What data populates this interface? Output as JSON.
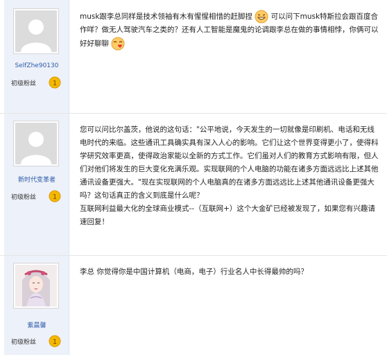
{
  "posts": [
    {
      "username": "SelfZhe90130",
      "rank": "初级粉丝",
      "medal": "1",
      "avatar": "default-avatar",
      "text_parts": [
        "musk跟李总同样是技术领袖有木有惺惺相惜的赶脚捏",
        "可以问下musk特斯拉会跟百度合作咩？做无人驾驶汽车之类的？还有人工智能是魔鬼的论调跟李总在做的事情相悖，你俩可以好好聊聊",
        ""
      ]
    },
    {
      "username": "新时代变革者",
      "rank": "初级粉丝",
      "medal": "1",
      "avatar": "default-avatar",
      "lines": [
        "您可以问比尔盖茨，他说的这句话：\"公平地说，今天发生的一切就像是印刷机、电话和无线电时代的来临。这些通讯工具确实具有深入人心的影响。它们让这个世界变得更小了，使得科学研究效率更高，使得政治家能以全新的方式工作。它们虽对人们的教育方式影响有限，但人们对他们将发生的巨大变化充满乐观。实现联网的个人电脑的功能在诸多方面远远比上述其他通讯设备更强大。\"现在实现联网的个人电脑真的在诸多方面远远比上述其他通讯设备更强大吗？这句话真正的含义到底是什么呢？",
        "互联网利益最大化的全球商业模式--（互联网+）这个大金矿已经被发现了，如果您有兴趣请速回复！"
      ]
    },
    {
      "username": "紫晨馨",
      "rank": "初级粉丝",
      "medal": "1",
      "avatar": "illustrated-avatar",
      "lines": [
        "李总 你觉得你是中国计算机（电商，电子）行业名人中长得最帅的吗？"
      ]
    }
  ],
  "colors": {
    "sidebar_bg": "#edf1f9",
    "username": "#2a5aa8",
    "medal": "#f5b800"
  }
}
